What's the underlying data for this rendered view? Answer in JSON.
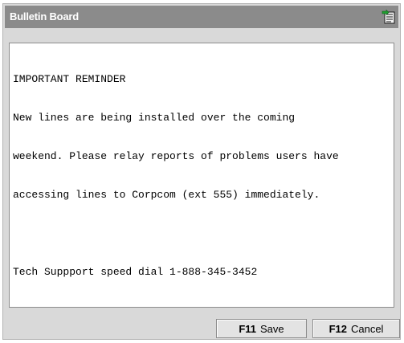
{
  "window": {
    "title": "Bulletin Board",
    "title_icon": "bulletin-board-icon"
  },
  "message": {
    "lines": [
      "IMPORTANT REMINDER",
      "New lines are being installed over the coming",
      "weekend. Please relay reports of problems users have",
      "accessing lines to Corpcom (ext 555) immediately.",
      "",
      "Tech Suppport speed dial 1-888-345-3452"
    ]
  },
  "buttons": {
    "save": {
      "key": "F11",
      "label": "Save"
    },
    "cancel": {
      "key": "F12",
      "label": "Cancel"
    }
  }
}
